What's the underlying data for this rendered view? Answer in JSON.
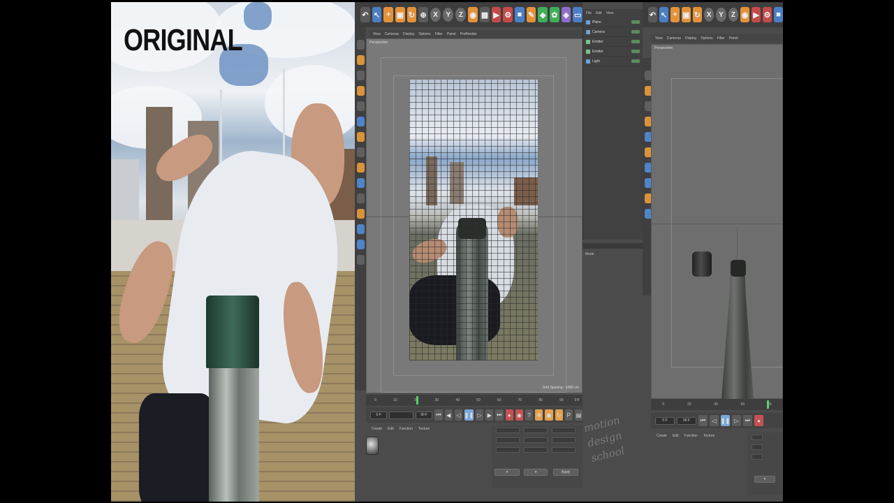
{
  "original_panel": {
    "label": "ORIGINAL"
  },
  "c4d": {
    "toolbar_axis_labels": [
      "X",
      "Y",
      "Z"
    ],
    "viewport_label": "Perspective",
    "grid_spacing": "Grid Spacing : 1000 cm",
    "menu_items": [
      "View",
      "Cameras",
      "Display",
      "Options",
      "Filter",
      "Panel",
      "ProRender"
    ],
    "object_manager": {
      "menu": [
        "File",
        "Edit",
        "View"
      ],
      "objects": [
        "Plane",
        "Camera",
        "Emitter",
        "Emitter",
        "Light"
      ]
    },
    "timeline_ticks": [
      "0",
      "10",
      "20",
      "30",
      "40",
      "50",
      "60",
      "70",
      "80",
      "90"
    ],
    "frame_readout": "0 F",
    "transport_fields": [
      "0 F",
      "90 F"
    ],
    "material_menu": [
      "Create",
      "Edit",
      "Function",
      "Texture"
    ],
    "apply_button": "Apply",
    "attr_mode": "Mode"
  },
  "watermark": {
    "lines": [
      "motion",
      "design",
      "school"
    ]
  },
  "colors": {
    "accent_blue": "#4a7fc4",
    "accent_orange": "#e3923a",
    "playhead": "#54d36a",
    "record": "#c55252"
  }
}
